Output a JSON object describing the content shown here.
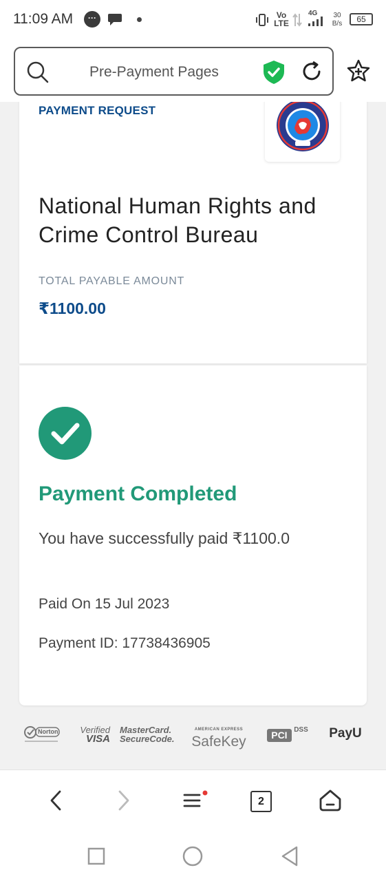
{
  "status_bar": {
    "time": "11:09 AM",
    "network_volte": "Vo\nLTE",
    "network_gen": "4G",
    "speed_value": "30",
    "speed_unit": "B/s",
    "battery": "65"
  },
  "browser": {
    "address_text": "Pre-Payment Pages",
    "tab_count": "2"
  },
  "payment": {
    "request_label": "PAYMENT REQUEST",
    "organization": "National Human Rights and Crime Control Bureau",
    "amount_label": "TOTAL PAYABLE AMOUNT",
    "amount": "₹1100.00",
    "status_title": "Payment Completed",
    "status_message": "You have successfully paid ₹1100.0",
    "paid_on": "Paid On 15 Jul 2023",
    "payment_id": "Payment ID: 17738436905"
  },
  "badges": {
    "norton": "Norton",
    "verified_visa_line1": "Verified",
    "verified_visa_line2": "VISA",
    "mastercard_line1": "MasterCard.",
    "mastercard_line2": "SecureCode.",
    "amex_line1": "AMERICAN EXPRESS",
    "amex_line2": "SafeKey",
    "pci": "PCI",
    "pci_dss": "DSS",
    "payu": "PayU"
  },
  "colors": {
    "brand_blue": "#0d4b8a",
    "success_green": "#219978"
  }
}
